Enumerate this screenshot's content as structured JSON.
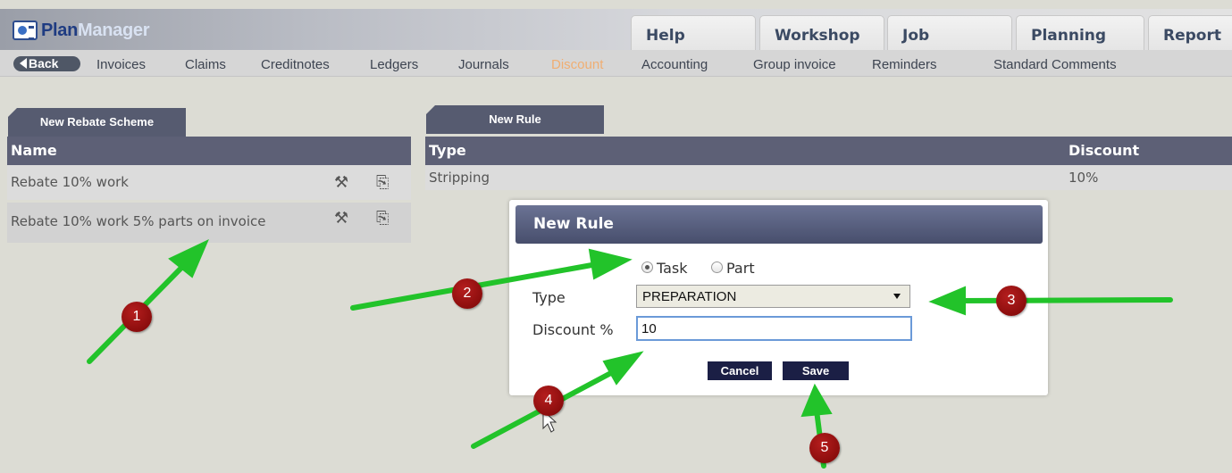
{
  "app": {
    "logo_part1": "Plan",
    "logo_part2": "Manager"
  },
  "main_tabs": [
    "Help",
    "Workshop",
    "Job",
    "Planning",
    "Report"
  ],
  "subnav": {
    "back_label": "Back",
    "items": [
      "Invoices",
      "Claims",
      "Creditnotes",
      "Ledgers",
      "Journals",
      "Discount",
      "Accounting",
      "Group invoice",
      "Reminders",
      "Standard Comments"
    ],
    "active": "Discount"
  },
  "schemes": {
    "tab_label": "New Rebate Scheme",
    "header": "Name",
    "rows": [
      "Rebate 10% work",
      "Rebate 10% work 5% parts on invoice"
    ]
  },
  "rules": {
    "tab_label": "New Rule",
    "headers": {
      "type": "Type",
      "discount": "Discount"
    },
    "rows": [
      {
        "type": "Stripping",
        "discount": "10%"
      }
    ]
  },
  "dialog": {
    "title": "New Rule",
    "radio_task": "Task",
    "radio_part": "Part",
    "selected": "Task",
    "type_label": "Type",
    "type_value": "PREPARATION",
    "discount_label": "Discount %",
    "discount_value": "10",
    "cancel_label": "Cancel",
    "save_label": "Save"
  },
  "annotations": {
    "badges": [
      "1",
      "2",
      "3",
      "4",
      "5"
    ],
    "arrow_color": "#22c32a",
    "badge_color": "#8c0a0a"
  },
  "colors": {
    "header": "#5d6076",
    "accent_active": "#f0ae72",
    "button": "#1b1f45"
  }
}
